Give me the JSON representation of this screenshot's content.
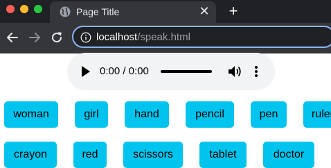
{
  "browser": {
    "tab_title": "Page Title",
    "url_host": "localhost",
    "url_path": "/speak.html",
    "new_tab_symbol": "+",
    "close_symbol": "✕"
  },
  "audio_player": {
    "time_display": "0:00 / 0:00",
    "progress": 0
  },
  "words": {
    "row1": [
      "woman",
      "girl",
      "hand",
      "pencil",
      "pen",
      "ruler"
    ],
    "row2": [
      "crayon",
      "red",
      "scissors",
      "tablet",
      "doctor"
    ]
  },
  "colors": {
    "word_button_bg": "#00c4ee",
    "audio_bg": "#f1f3f4",
    "omnibox_focus": "#8ab4f8"
  }
}
